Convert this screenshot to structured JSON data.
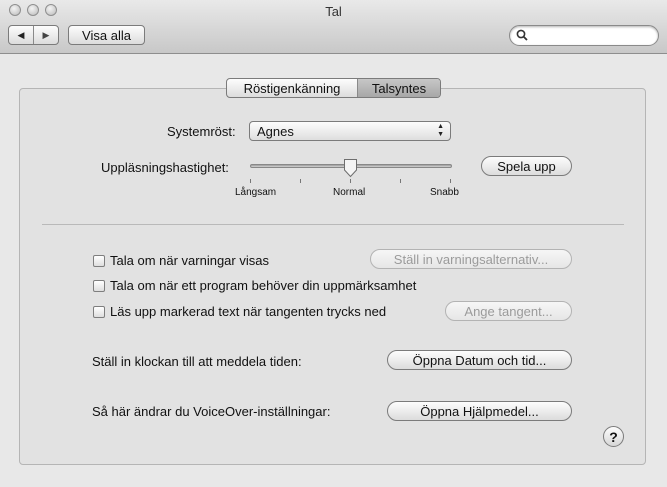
{
  "window": {
    "title": "Tal"
  },
  "toolbar": {
    "back_glyph": "◀",
    "forward_glyph": "▶",
    "show_all": "Visa alla",
    "search_placeholder": ""
  },
  "tabs": [
    {
      "label": "Röstigenkänning",
      "selected": false
    },
    {
      "label": "Talsyntes",
      "selected": true
    }
  ],
  "voice": {
    "label": "Systemröst:",
    "value": "Agnes"
  },
  "rate": {
    "label": "Uppläsningshastighet:",
    "value_fraction": 0.5,
    "min_label": "Långsam",
    "mid_label": "Normal",
    "max_label": "Snabb",
    "play_button": "Spela upp"
  },
  "options": {
    "alerts": {
      "label": "Tala om när varningar visas",
      "checked": false,
      "button": "Ställ in varningsalternativ..."
    },
    "attention": {
      "label": "Tala om när ett program behöver din uppmärksamhet",
      "checked": false
    },
    "selected_text": {
      "label": "Läs upp markerad text när tangenten trycks ned",
      "checked": false,
      "button": "Ange tangent..."
    }
  },
  "clock": {
    "label": "Ställ in klockan till att meddela tiden:",
    "button": "Öppna Datum och tid..."
  },
  "voiceover": {
    "label": "Så här ändrar du VoiceOver-inställningar:",
    "button": "Öppna Hjälpmedel..."
  },
  "help": {
    "glyph": "?"
  }
}
